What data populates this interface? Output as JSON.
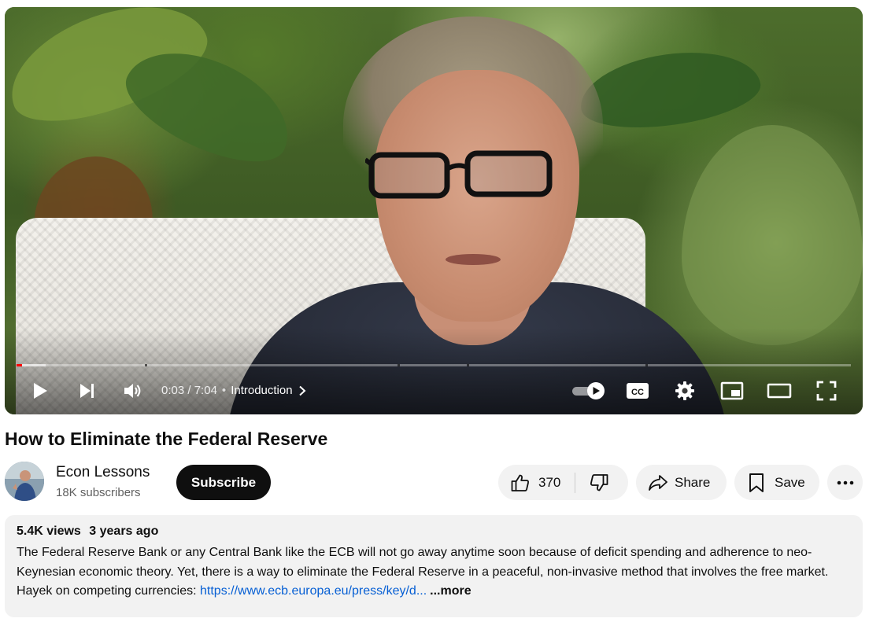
{
  "player": {
    "current_time": "0:03",
    "duration": "7:04",
    "time_separator": " / ",
    "chapter_dot": "•",
    "chapter": "Introduction",
    "played_fraction": 0.007,
    "buffered_fraction": 0.035,
    "chapter_marks_fraction": [
      0.154,
      0.457,
      0.54,
      0.754
    ]
  },
  "video": {
    "title": "How to Eliminate the Federal Reserve"
  },
  "channel": {
    "name": "Econ Lessons",
    "subscribers": "18K subscribers",
    "subscribe_label": "Subscribe"
  },
  "actions": {
    "like_count": "370",
    "share_label": "Share",
    "save_label": "Save"
  },
  "description": {
    "views": "5.4K views",
    "age": "3 years ago",
    "text": "The Federal Reserve Bank or any Central Bank like the ECB will not go away anytime soon because of deficit spending and adherence to neo-Keynesian economic theory. Yet, there is a way to eliminate the Federal Reserve in a peaceful, non-invasive method that involves the free market. Hayek on competing currencies: ",
    "link": "https://www.ecb.europa.eu/press/key/d...",
    "more_label": "...more"
  },
  "icons": {
    "player": [
      "play-icon",
      "next-icon",
      "volume-icon",
      "chevron-right-icon",
      "autoplay-toggle-icon",
      "captions-icon",
      "settings-gear-icon",
      "miniplayer-icon",
      "theater-mode-icon",
      "fullscreen-icon"
    ],
    "actions": [
      "thumbs-up-icon",
      "thumbs-down-icon",
      "share-arrow-icon",
      "bookmark-icon",
      "more-horizontal-icon"
    ]
  },
  "colors": {
    "progress_played": "#ff0000",
    "subscribe_bg": "#0f0f0f",
    "link": "#065fd4",
    "pill_bg": "#f2f2f2"
  }
}
